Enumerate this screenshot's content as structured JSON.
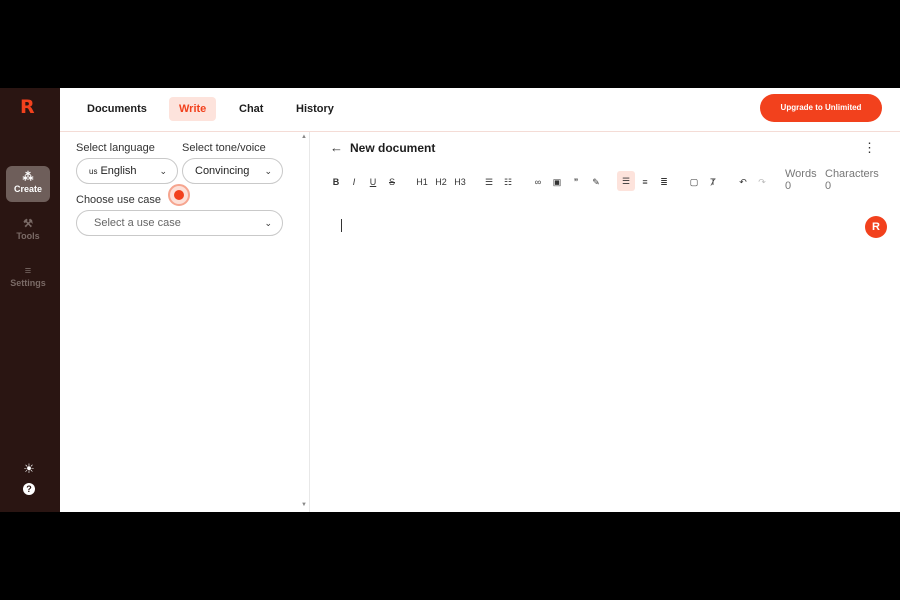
{
  "sidebar": {
    "logo": "R",
    "items": [
      {
        "label": "Create",
        "icon": "sparkle-icon",
        "glyph": "⁂"
      },
      {
        "label": "Tools",
        "icon": "wrench-icon",
        "glyph": "⚒"
      },
      {
        "label": "Settings",
        "icon": "sliders-icon",
        "glyph": "≡"
      }
    ],
    "bottom": [
      {
        "icon": "sun-icon",
        "glyph": "☀"
      },
      {
        "icon": "help-icon",
        "glyph": "?"
      }
    ]
  },
  "topbar": {
    "tabs": [
      "Documents",
      "Write",
      "Chat",
      "History"
    ],
    "active_tab": "Write",
    "upgrade_label": "Upgrade to Unlimited"
  },
  "left_panel": {
    "language_label": "Select language",
    "language_flag": "us",
    "language_value": "English",
    "tone_label": "Select tone/voice",
    "tone_value": "Convincing",
    "use_case_label": "Choose use case",
    "use_case_placeholder": "Select a use case"
  },
  "editor": {
    "title": "New document",
    "toolbar": {
      "bold": "B",
      "italic": "I",
      "underline": "U",
      "strike": "S",
      "h1": "H1",
      "h2": "H2",
      "h3": "H3"
    },
    "words_label": "Words",
    "words_value": "0",
    "characters_label": "Characters",
    "characters_value": "0",
    "fab_label": "R"
  },
  "colors": {
    "accent": "#f2411d",
    "sidebar_bg": "#2a1512",
    "active_tab_bg": "#fde3dc"
  }
}
